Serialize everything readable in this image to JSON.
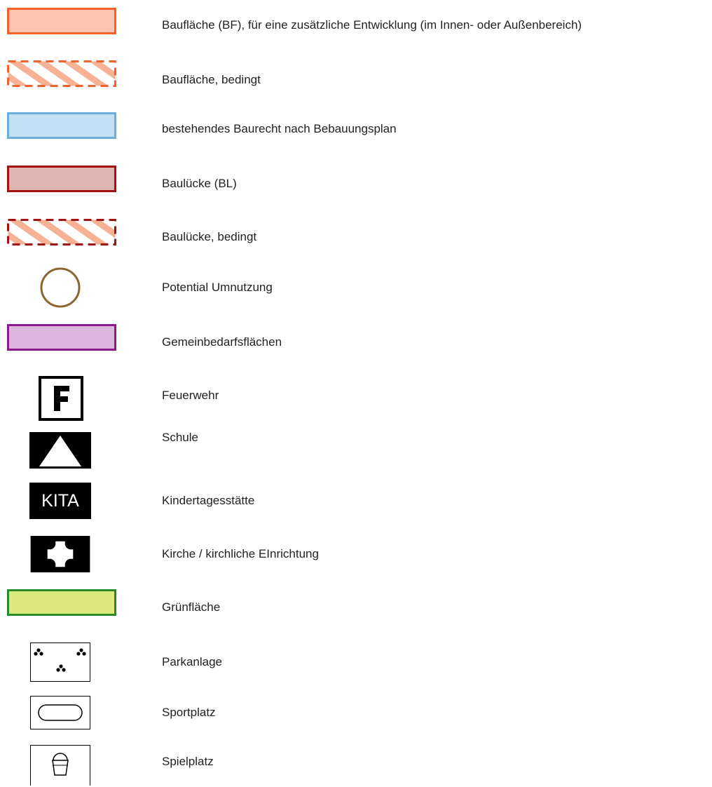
{
  "legend": {
    "items": [
      {
        "id": "bauflaeche",
        "label": "Baufläche (BF), für eine zusätzliche Entwicklung (im Innen- oder Außenbereich)",
        "fill": "#fcc4ae",
        "stroke": "#f2622e"
      },
      {
        "id": "bauflaeche-bedingt",
        "label": "Baufläche, bedingt",
        "fill": "#f7b295",
        "stroke": "#f2622e"
      },
      {
        "id": "baurecht",
        "label": "bestehendes Baurecht nach Bebauungsplan",
        "fill": "#c5e0f4",
        "stroke": "#6baedb"
      },
      {
        "id": "bauluecke",
        "label": "Baulücke (BL)",
        "fill": "#e0b3b5",
        "stroke": "#a01414"
      },
      {
        "id": "bauluecke-bedingt",
        "label": "Baulücke, bedingt",
        "fill": "#f7b295",
        "stroke": "#a01414"
      },
      {
        "id": "umnutzung",
        "label": "Potential Umnutzung",
        "stroke": "#8b6532"
      },
      {
        "id": "gemeinbedarf",
        "label": "Gemeinbedarfsflächen",
        "fill": "#dab5dc",
        "stroke": "#8c1a8c"
      },
      {
        "id": "feuerwehr",
        "label": "Feuerwehr",
        "glyph": "F"
      },
      {
        "id": "schule",
        "label": "Schule"
      },
      {
        "id": "kita",
        "label": "Kindertagesstätte",
        "glyph": "KITA"
      },
      {
        "id": "kirche",
        "label": "Kirche / kirchliche EInrichtung"
      },
      {
        "id": "gruenflaeche",
        "label": "Grünfläche",
        "fill": "#dde97f",
        "stroke": "#2a8a2a"
      },
      {
        "id": "parkanlage",
        "label": "Parkanlage"
      },
      {
        "id": "sportplatz",
        "label": "Sportplatz"
      },
      {
        "id": "spielplatz",
        "label": "Spielplatz"
      }
    ]
  }
}
